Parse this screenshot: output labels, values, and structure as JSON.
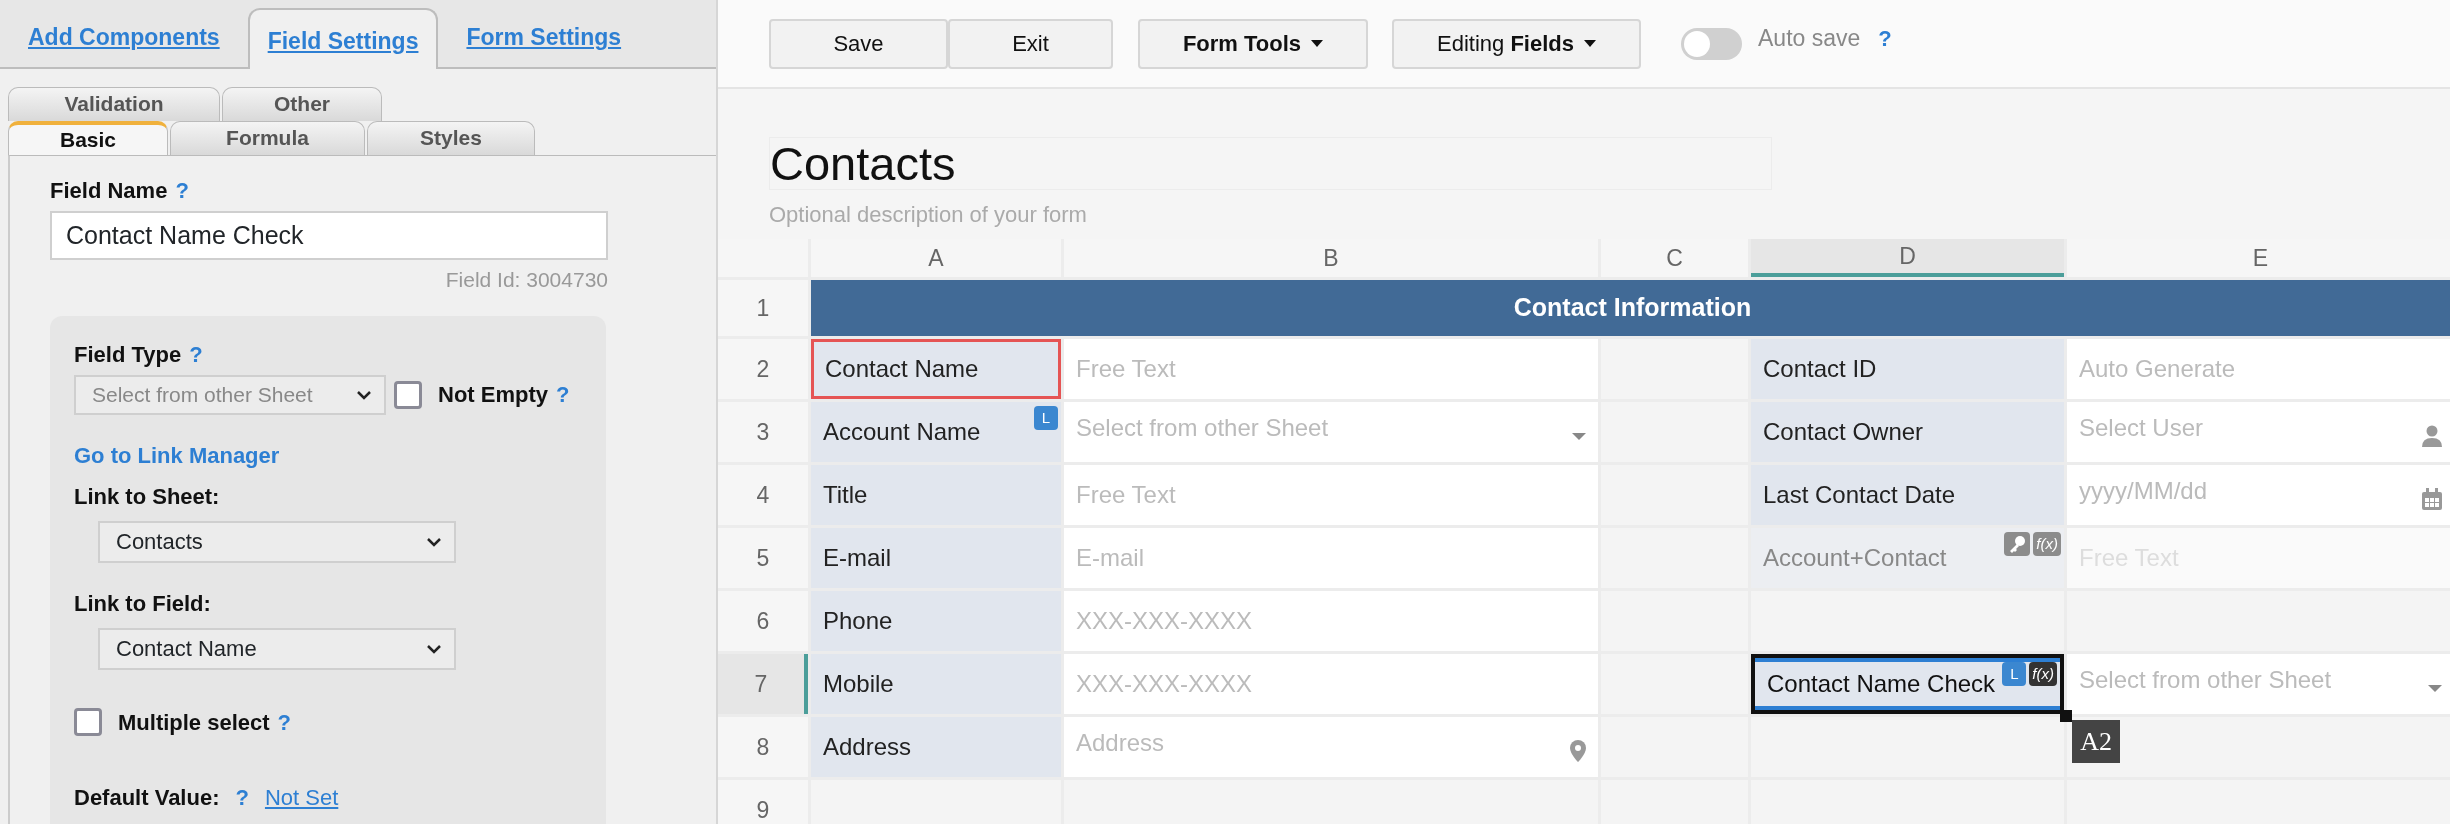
{
  "panel_tabs": [
    {
      "label": "Add Components",
      "selected": false
    },
    {
      "label": "Field Settings",
      "selected": true
    },
    {
      "label": "Form Settings",
      "selected": false
    }
  ],
  "sub_tabs": {
    "back_row": [
      {
        "label": "Validation",
        "selected": false
      },
      {
        "label": "Other",
        "selected": false
      }
    ],
    "front_row": [
      {
        "label": "Basic",
        "selected": true
      },
      {
        "label": "Formula",
        "selected": false
      },
      {
        "label": "Styles",
        "selected": false
      }
    ]
  },
  "field_name": {
    "label": "Field Name",
    "help": "?",
    "value": "Contact Name Check",
    "field_id": "Field Id: 3004730"
  },
  "field_type": {
    "label": "Field Type",
    "help": "?",
    "value": "Select from other Sheet",
    "disabled": true
  },
  "not_empty": {
    "label": "Not Empty",
    "help": "?",
    "checked": false
  },
  "link_manager": "Go to Link Manager",
  "link_sheet": {
    "label": "Link to Sheet:",
    "value": "Contacts"
  },
  "link_field": {
    "label": "Link to Field:",
    "value": "Contact Name"
  },
  "multiple_select": {
    "label": "Multiple select",
    "help": "?",
    "checked": false
  },
  "default_value": {
    "label": "Default Value:",
    "help": "?",
    "value": "Not Set"
  },
  "toolbar": {
    "buttons": [
      {
        "label": "Save",
        "kind": "plain",
        "bold": false
      },
      {
        "label": "Exit",
        "kind": "plain",
        "bold": false
      },
      {
        "label": "Form Tools",
        "kind": "menu",
        "bold": true
      },
      {
        "label": "Editing **Fields**",
        "kind": "menu",
        "bold": false
      }
    ],
    "auto_save": {
      "label": "Auto save",
      "help": "?",
      "on": false
    }
  },
  "form": {
    "title": "Contacts",
    "description": "Optional description of your form"
  },
  "grid": {
    "columns": [
      {
        "label": "A",
        "selected": false
      },
      {
        "label": "B",
        "selected": false
      },
      {
        "label": "C",
        "selected": false
      },
      {
        "label": "D",
        "selected": true
      },
      {
        "label": "E",
        "selected": false
      }
    ],
    "section_header": {
      "row_label": "1",
      "text": "Contact Information"
    },
    "rows": [
      {
        "label": "2",
        "selected": false,
        "cells": [
          {
            "kind": "label",
            "text": "Contact Name",
            "selected": false,
            "referenced": true
          },
          {
            "kind": "text-input",
            "placeholder": "Free Text",
            "selected": false
          },
          {
            "kind": "blank",
            "selected": false
          },
          {
            "kind": "label",
            "text": "Contact ID",
            "selected": false,
            "referenced": false
          },
          {
            "kind": "text-input",
            "placeholder": "Auto Generate",
            "selected": false
          }
        ]
      },
      {
        "label": "3",
        "selected": false,
        "cells": [
          {
            "kind": "label",
            "text": "Account Name",
            "badges": [
              "L"
            ],
            "selected": false,
            "referenced": false
          },
          {
            "kind": "select-input",
            "placeholder": "Select from other Sheet",
            "selected": false
          },
          {
            "kind": "blank",
            "selected": false
          },
          {
            "kind": "label",
            "text": "Contact Owner",
            "selected": false,
            "referenced": false
          },
          {
            "kind": "user-input",
            "placeholder": "Select User",
            "selected": false
          }
        ]
      },
      {
        "label": "4",
        "selected": false,
        "cells": [
          {
            "kind": "label",
            "text": "Title",
            "selected": false,
            "referenced": false
          },
          {
            "kind": "text-input",
            "placeholder": "Free Text",
            "selected": false
          },
          {
            "kind": "blank",
            "selected": false
          },
          {
            "kind": "label",
            "text": "Last Contact Date",
            "selected": false,
            "referenced": false
          },
          {
            "kind": "date-input",
            "placeholder": "yyyy/MM/dd",
            "selected": false
          }
        ]
      },
      {
        "label": "5",
        "selected": false,
        "cells": [
          {
            "kind": "label",
            "text": "E-mail",
            "selected": false,
            "referenced": false
          },
          {
            "kind": "text-input",
            "placeholder": "E-mail",
            "selected": false
          },
          {
            "kind": "blank",
            "selected": false
          },
          {
            "kind": "formula-label",
            "text": "Account+Contact",
            "badges": [
              "f(x)"
            ],
            "selected": false,
            "referenced": false
          },
          {
            "kind": "disabled-input",
            "placeholder": "Free Text",
            "selected": false
          }
        ]
      },
      {
        "label": "6",
        "selected": false,
        "cells": [
          {
            "kind": "label",
            "text": "Phone",
            "selected": false,
            "referenced": false
          },
          {
            "kind": "text-input",
            "placeholder": "XXX-XXX-XXXX",
            "selected": false
          },
          {
            "kind": "blank",
            "selected": false
          },
          {
            "kind": "blank",
            "selected": false
          },
          {
            "kind": "blank",
            "selected": false
          }
        ]
      },
      {
        "label": "7",
        "selected": true,
        "cells": [
          {
            "kind": "label",
            "text": "Mobile",
            "selected": false,
            "referenced": false
          },
          {
            "kind": "text-input",
            "placeholder": "XXX-XXX-XXXX",
            "selected": false
          },
          {
            "kind": "blank",
            "selected": false
          },
          {
            "kind": "label",
            "text": "Contact Name Check",
            "badges": [
              "L",
              "f(x)"
            ],
            "selected": true,
            "referenced": false,
            "tooltip": "A2"
          },
          {
            "kind": "select-input",
            "placeholder": "Select from other Sheet",
            "selected": false
          }
        ]
      },
      {
        "label": "8",
        "selected": false,
        "cells": [
          {
            "kind": "label",
            "text": "Address",
            "selected": false,
            "referenced": false
          },
          {
            "kind": "address-input",
            "placeholder": "Address",
            "selected": false
          },
          {
            "kind": "blank",
            "selected": false
          },
          {
            "kind": "blank",
            "selected": false
          },
          {
            "kind": "blank",
            "selected": false
          }
        ]
      },
      {
        "label": "9",
        "selected": false,
        "cells": [
          {
            "kind": "blank",
            "selected": false
          },
          {
            "kind": "blank",
            "selected": false
          },
          {
            "kind": "blank",
            "selected": false
          },
          {
            "kind": "blank",
            "selected": false
          },
          {
            "kind": "blank",
            "selected": false
          }
        ]
      }
    ]
  }
}
